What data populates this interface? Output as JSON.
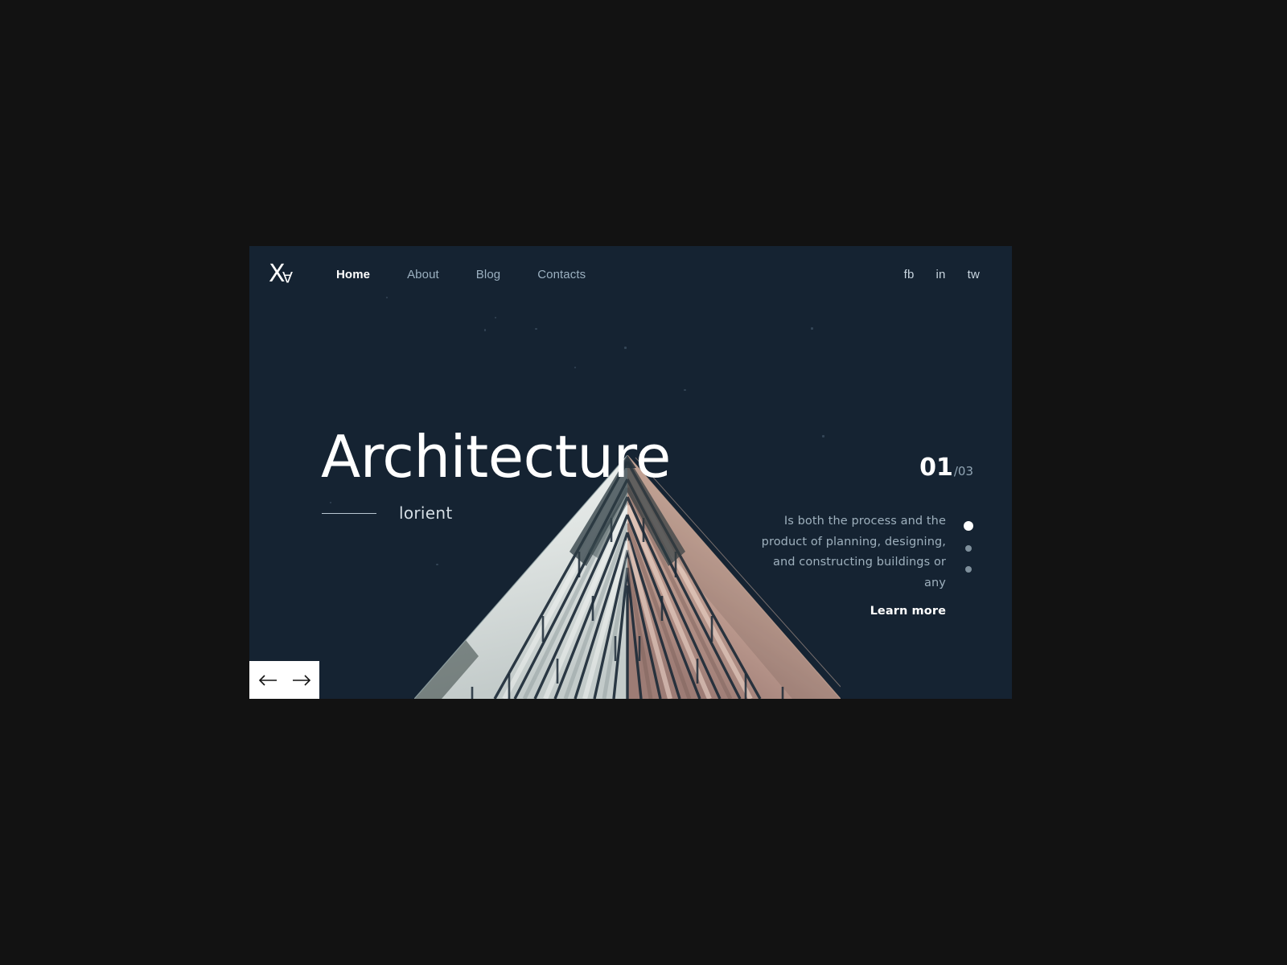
{
  "theme": {
    "page_bg": "#121212",
    "card_bg": "#152332",
    "accent_white": "#ffffff",
    "muted_text": "#9eb0bd",
    "nav_inactive": "#9bb0c0"
  },
  "logo": {
    "mark_primary": "X",
    "mark_secondary": "A",
    "name": "logo-xa"
  },
  "nav": {
    "items": [
      {
        "label": "Home",
        "active": true
      },
      {
        "label": "About",
        "active": false
      },
      {
        "label": "Blog",
        "active": false
      },
      {
        "label": "Contacts",
        "active": false
      }
    ]
  },
  "social": {
    "items": [
      {
        "label": "fb"
      },
      {
        "label": "in"
      },
      {
        "label": "tw"
      }
    ]
  },
  "hero": {
    "title": "Architecture",
    "subtitle": "lorient",
    "description": "Is both the process and the product of planning, designing, and constructing buildings or any",
    "cta_label": "Learn more"
  },
  "slider": {
    "current": "01",
    "total": "/03",
    "dots": [
      {
        "active": true
      },
      {
        "active": false
      },
      {
        "active": false
      }
    ],
    "prev_label": "←",
    "next_label": "→"
  },
  "image": {
    "alt": "triangular-building-corner",
    "left_face_colors": [
      "#eef1ef",
      "#d6dbd9",
      "#b9c2c2",
      "#9aa6a7"
    ],
    "right_face_colors": [
      "#ecd2c5",
      "#d6b2a2",
      "#a2807a",
      "#7d625e"
    ],
    "mullion_color": "#1d2b38"
  }
}
